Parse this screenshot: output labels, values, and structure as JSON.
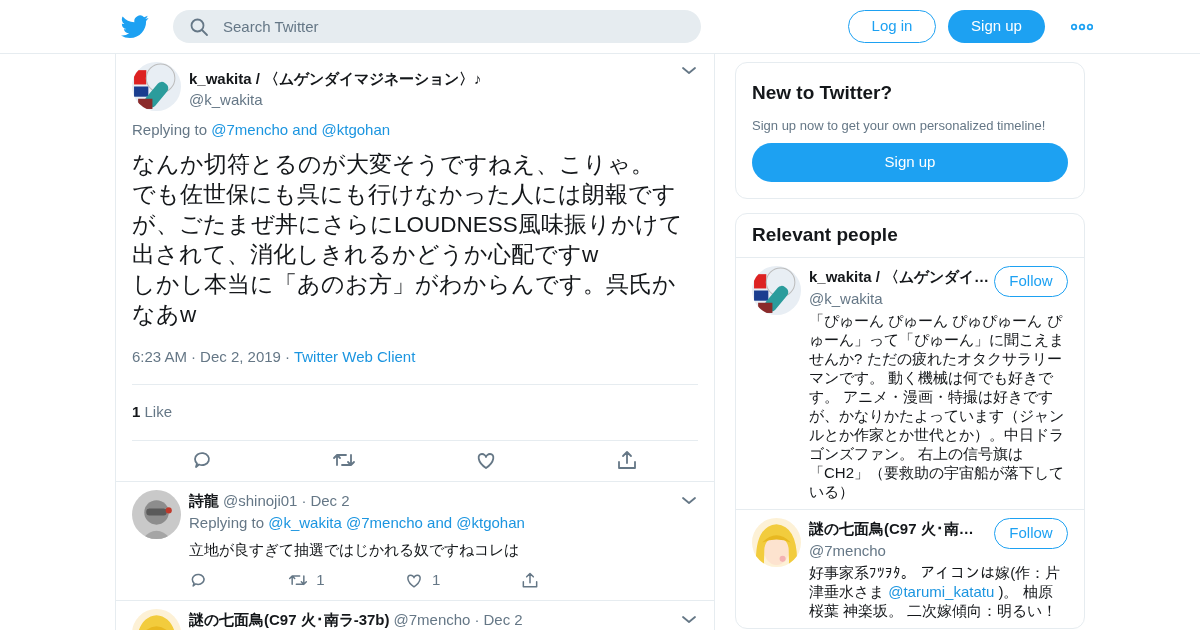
{
  "header": {
    "search": {
      "placeholder": "Search Twitter"
    },
    "login": "Log in",
    "signup": "Sign up"
  },
  "main_tweet": {
    "name": "k_wakita / 〈ムゲンダイマジネーション〉♪",
    "handle": "@k_wakita",
    "replying_prefix": "Replying to",
    "replying_to": "@7mencho and @ktgohan",
    "text_lines": [
      "なんか切符とるのが大変そうですねえ、こりゃ。",
      "でも佐世保にも呉にも行けなかった人には朗報ですが、ごたまぜ丼にさらにLOUDNESS風味振りかけて出されて、消化しきれるかどうか心配ですw",
      "しかし本当に「あのお方」がわからんです。呉氏かなあw"
    ],
    "separator": "·",
    "time": "6:23 AM",
    "date": "Dec 2, 2019",
    "source": "Twitter Web Client",
    "likes_count": "1",
    "likes_label": "Like"
  },
  "replies": [
    {
      "name": "詩龍",
      "handle": "@shinoji01",
      "separator": "·",
      "date": "Dec 2",
      "replying_prefix": "Replying to",
      "replying_to": "@k_wakita @7mencho and @ktgohan",
      "text": "立地が良すぎて抽選ではじかれる奴ですねコレは",
      "retweets": "1",
      "likes": "1"
    },
    {
      "name": "謎の七面鳥(C97 火･南ラ-37b)",
      "handle": "@7mencho",
      "separator": "·",
      "date": "Dec 2"
    }
  ],
  "new_to_twitter": {
    "title": "New to Twitter?",
    "subtitle": "Sign up now to get your own personalized timeline!",
    "button": "Sign up"
  },
  "relevant_people": {
    "title": "Relevant people",
    "people": [
      {
        "name": "k_wakita / 〈ムゲンダイ…",
        "handle": "@k_wakita",
        "follow": "Follow",
        "bio_lines": [
          [
            {
              "text": "「ぴゅーん ぴゅーん ぴゅぴゅーん ぴ"
            }
          ],
          [
            {
              "text": "ゅーん」って「ぴゅーん」に聞こえま"
            }
          ],
          [
            {
              "text": "せんか? ただの疲れたオタクサラリー"
            }
          ],
          [
            {
              "text": "マンです。 動く機械は何でも好きで"
            }
          ],
          [
            {
              "text": "す。 アニメ・漫画・特撮は好きです"
            }
          ],
          [
            {
              "text": "が、かなりかたよっています（ジャン"
            }
          ],
          [
            {
              "text": "ルとか作家とか世代とか）。中日ドラ"
            }
          ],
          [
            {
              "text": "ゴンズファン。 右上の信号旗は"
            }
          ],
          [
            {
              "text": "「CH2」（要救助の宇宙船が落下して"
            }
          ],
          [
            {
              "text": "いる）"
            }
          ]
        ]
      },
      {
        "name": "謎の七面鳥(C97 火･南…",
        "handle": "@7mencho",
        "follow": "Follow",
        "bio_lines": [
          [
            {
              "text": "好事家系ﾌﾂｦﾀ。 アイコンは嫁(作：片"
            }
          ],
          [
            {
              "text": "津垂水さま "
            },
            {
              "text": "@tarumi_katatu",
              "kind": "link"
            },
            {
              "text": " )。 柚原"
            }
          ],
          [
            {
              "text": "桜葉 神楽坂。 二次嫁傾向：明るい！"
            }
          ]
        ]
      }
    ]
  }
}
